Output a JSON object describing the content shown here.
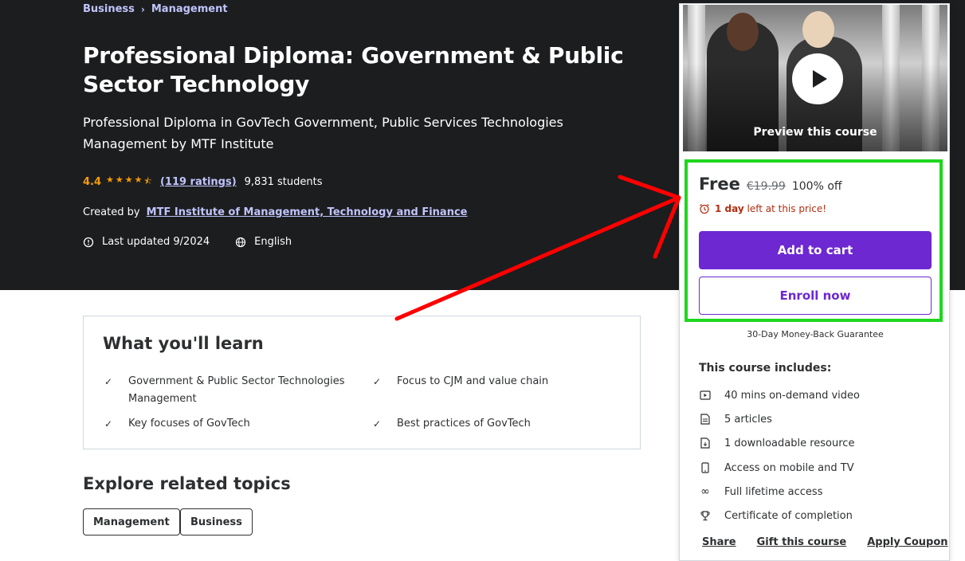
{
  "breadcrumb": {
    "items": [
      "Business",
      "Management"
    ]
  },
  "course": {
    "title": "Professional Diploma: Government & Public Sector Technology",
    "subtitle": "Professional Diploma in GovTech Government, Public Services Technologies Management by MTF Institute",
    "rating": "4.4",
    "rating_value": 4.4,
    "ratings_count": "(119 ratings)",
    "students": "9,831 students",
    "created_by_label": "Created by",
    "author": "MTF Institute of Management, Technology and Finance",
    "last_updated": "Last updated 9/2024",
    "language": "English"
  },
  "learn": {
    "title": "What you'll learn",
    "items": [
      "Government & Public Sector Technologies Management",
      "Focus to CJM and value chain",
      "Key focuses of GovTech",
      "Best practices of GovTech"
    ]
  },
  "explore": {
    "title": "Explore related topics",
    "topics": [
      "Management",
      "Business"
    ]
  },
  "sidebar": {
    "preview_label": "Preview this course",
    "price": "Free",
    "old_price": "€19.99",
    "discount": "100% off",
    "timer_bold": "1 day",
    "timer_rest": "left at this price!",
    "add_to_cart": "Add to cart",
    "enroll": "Enroll now",
    "guarantee": "30-Day Money-Back Guarantee",
    "includes_title": "This course includes:",
    "includes": [
      "40 mins on-demand video",
      "5 articles",
      "1 downloadable resource",
      "Access on mobile and TV",
      "Full lifetime access",
      "Certificate of completion"
    ],
    "links": [
      "Share",
      "Gift this course",
      "Apply Coupon"
    ]
  },
  "colors": {
    "accent": "#6d28d2",
    "highlight": "#1ed71e",
    "arrow": "#ff0000",
    "hero_bg": "#1c1d1f",
    "star": "#f69c08"
  }
}
